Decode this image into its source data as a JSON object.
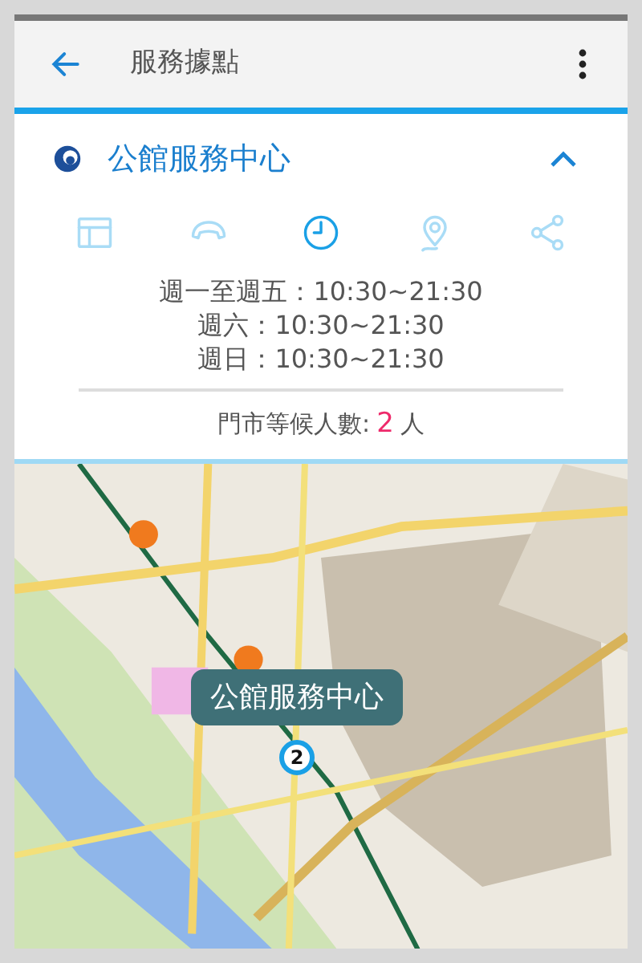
{
  "app_bar": {
    "title": "服務據點"
  },
  "store": {
    "name": "公館服務中心",
    "expanded": true
  },
  "tabs": [
    {
      "kind": "info",
      "selected": false
    },
    {
      "kind": "phone",
      "selected": false
    },
    {
      "kind": "hours",
      "selected": true
    },
    {
      "kind": "location",
      "selected": false
    },
    {
      "kind": "share",
      "selected": false
    }
  ],
  "hours": [
    "週一至週五：10:30~21:30",
    "週六：10:30~21:30",
    "週日：10:30~21:30"
  ],
  "waiting": {
    "label": "門市等候人數:",
    "count": "2",
    "unit": "人"
  },
  "map": {
    "callout": "公館服務中心",
    "marker_count": "2"
  }
}
